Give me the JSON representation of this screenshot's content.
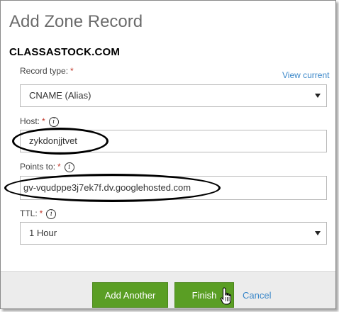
{
  "dialog": {
    "title": "Add Zone Record",
    "domain": "CLASSASTOCK.COM"
  },
  "record_type": {
    "label": "Record type:",
    "required": "*",
    "view_current": "View current",
    "value": "CNAME (Alias)"
  },
  "host": {
    "label": "Host:",
    "required": "*",
    "info": "i",
    "value": "zykdonjjtvet"
  },
  "points_to": {
    "label": "Points to:",
    "required": "*",
    "info": "i",
    "value": "gv-vqudppe3j7ek7f.dv.googlehosted.com"
  },
  "ttl": {
    "label": "TTL:",
    "required": "*",
    "info": "i",
    "value": "1 Hour"
  },
  "buttons": {
    "add_another": "Add Another",
    "finish": "Finish",
    "cancel": "Cancel"
  },
  "colors": {
    "accent_green": "#5a9e24",
    "link_blue": "#3a87c9",
    "required_red": "#c0392b"
  },
  "icons": {
    "dropdown": "chevron-down-icon",
    "info": "info-icon",
    "cursor": "hand-pointer-icon"
  }
}
